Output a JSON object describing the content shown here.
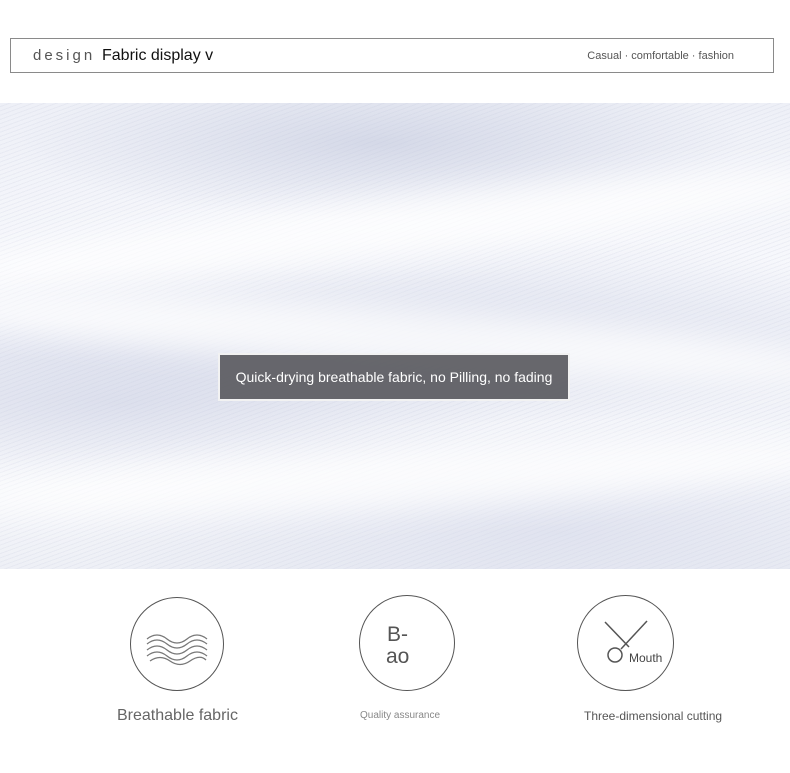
{
  "header": {
    "design": "design",
    "title": "Fabric display v",
    "tagline": "Casual · comfortable · fashion"
  },
  "fabric": {
    "caption": "Quick-drying breathable fabric, no Pilling, no fading"
  },
  "features": [
    {
      "icon": "waves-icon",
      "label": "Breathable fabric"
    },
    {
      "icon": "bao-icon",
      "glyph_top": "B-",
      "glyph_bottom": "ao",
      "label": "Quality assurance"
    },
    {
      "icon": "scissors-icon",
      "glyph": "Mouth",
      "label": "Three-dimensional cutting"
    }
  ],
  "colors": {
    "caption_bg": "#5f5f64",
    "border": "#8a8a8a",
    "text_muted": "#666666"
  }
}
